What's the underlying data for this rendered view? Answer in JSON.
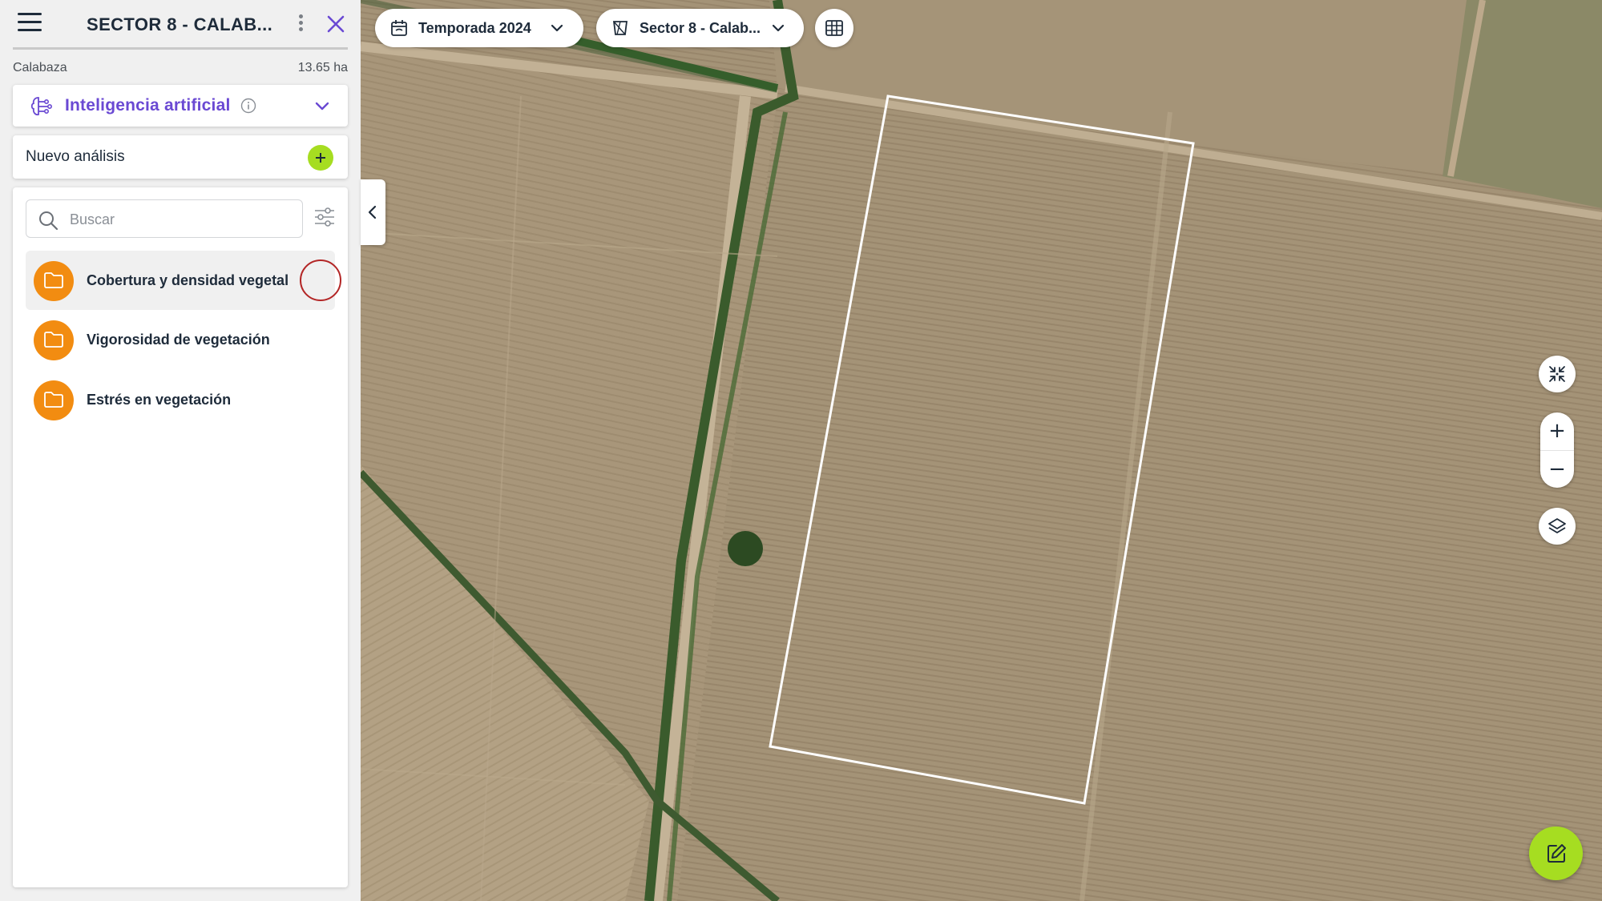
{
  "header": {
    "title": "SECTOR 8 - CALAB...",
    "crop": "Calabaza",
    "area": "13.65 ha"
  },
  "ai_section": {
    "label": "Inteligencia artificial"
  },
  "new_analysis": {
    "label": "Nuevo análisis"
  },
  "search": {
    "placeholder": "Buscar",
    "value": ""
  },
  "folders": [
    {
      "label": "Cobertura y densidad vegetal",
      "icon": "folder-icon"
    },
    {
      "label": "Vigorosidad de vegetación",
      "icon": "folder-icon"
    },
    {
      "label": "Estrés en vegetación",
      "icon": "folder-icon"
    }
  ],
  "map_toolbar": {
    "season": "Temporada 2024",
    "sector": "Sector 8 - Calab..."
  },
  "map_controls": {
    "zoom_in": "+",
    "zoom_out": "−"
  },
  "colors": {
    "accent_purple": "#6a49d3",
    "accent_green": "#a6dd21",
    "folder_orange": "#f28c11",
    "text_dark": "#1e2b3a",
    "field_outline": "#ffffff"
  }
}
